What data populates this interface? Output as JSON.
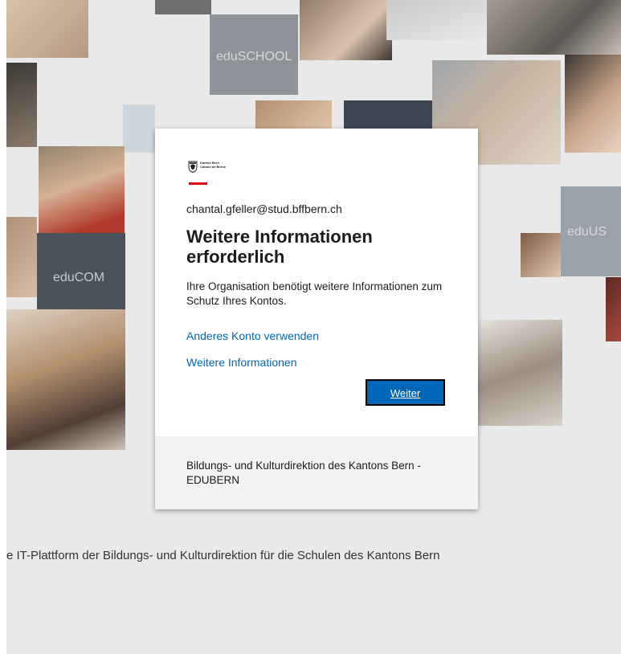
{
  "background": {
    "tile_labels": [
      "eduSCHOOL",
      "eduCOM",
      "eduUS"
    ],
    "footer_text": "e IT-Plattform der Bildungs- und Kulturdirektion für die Schulen des Kantons Bern"
  },
  "dialog": {
    "logo": {
      "line1": "Kanton Bern",
      "line2": "Canton de Berne"
    },
    "email": "chantal.gfeller@stud.bffbern.ch",
    "title": "Weitere Informationen erforderlich",
    "description": "Ihre Organisation benötigt weitere Informationen zum Schutz Ihres Kontos.",
    "link_other_account": "Anderes Konto verwenden",
    "link_more_info": "Weitere Informationen",
    "next_button": "Weiter",
    "organization": "Bildungs- und Kulturdirektion des Kantons Bern - EDUBERN"
  },
  "colors": {
    "accent": "#0067b8",
    "logo_red": "#e1001a",
    "footer_panel": "#f2f2f2"
  }
}
